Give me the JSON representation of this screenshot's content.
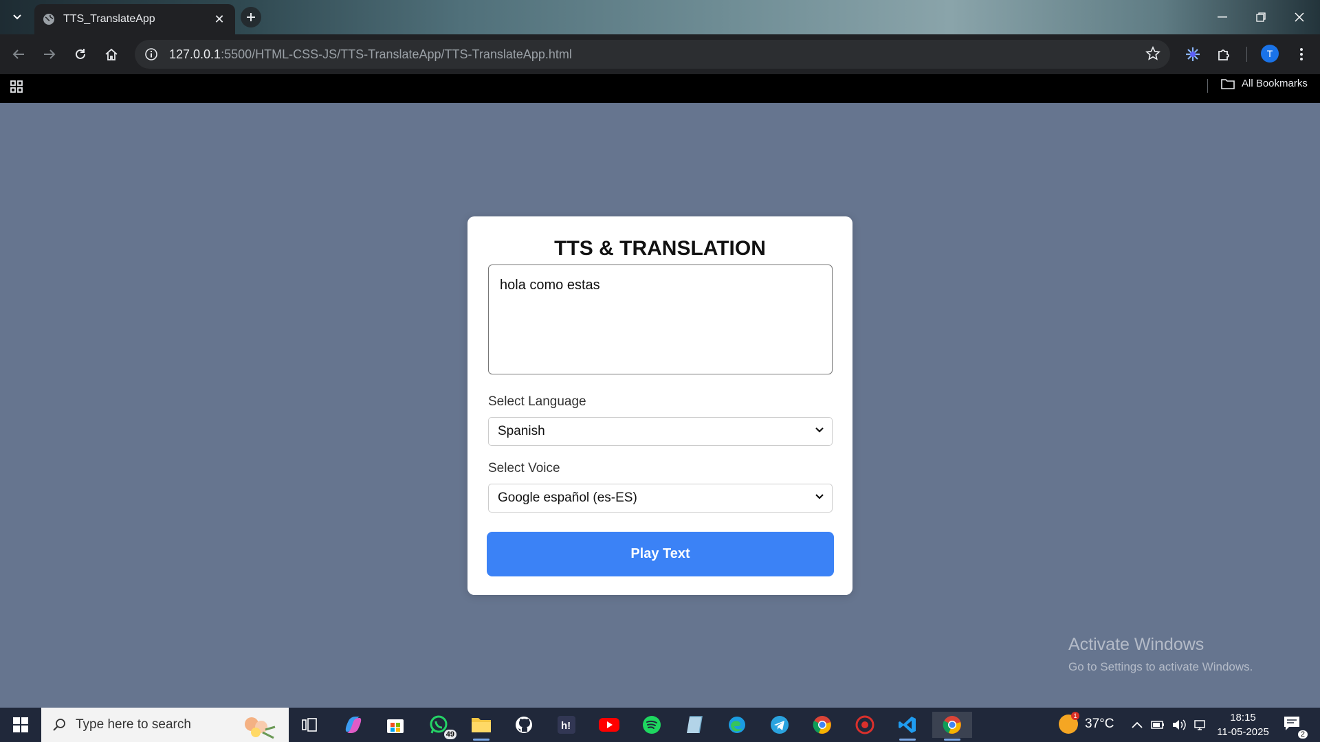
{
  "browser": {
    "tab_title": "TTS_TranslateApp",
    "url_host": "127.0.0.1",
    "url_path": ":5500/HTML-CSS-JS/TTS-TranslateApp/TTS-TranslateApp.html",
    "profile_initial": "T",
    "all_bookmarks_label": "All Bookmarks"
  },
  "app": {
    "title": "TTS & TRANSLATION",
    "text_value": "hola como estas",
    "language_label": "Select Language",
    "language_value": "Spanish",
    "voice_label": "Select Voice",
    "voice_value": "Google español (es-ES)",
    "play_label": "Play Text",
    "button_color": "#3b82f6",
    "background_color": "#66758f"
  },
  "watermark": {
    "line1": "Activate Windows",
    "line2": "Go to Settings to activate Windows."
  },
  "taskbar": {
    "search_placeholder": "Type here to search",
    "whatsapp_badge": "49",
    "temperature": "37°C",
    "weather_alert": "1",
    "time": "18:15",
    "date": "11-05-2025",
    "notification_count": "2",
    "apps": [
      "task-view",
      "copilot",
      "microsoft-store",
      "whatsapp",
      "file-explorer",
      "github",
      "hackerearth",
      "youtube",
      "spotify",
      "notes",
      "edge",
      "telegram",
      "chrome",
      "antivirus",
      "vscode",
      "chrome-active"
    ]
  }
}
